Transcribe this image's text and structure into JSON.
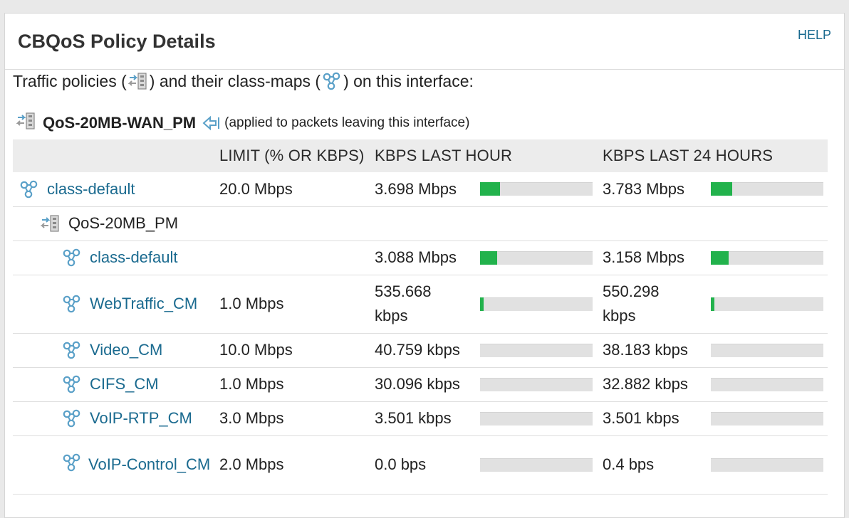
{
  "header": {
    "title": "CBQoS Policy Details",
    "help_label": "HELP"
  },
  "intro": {
    "part1": "Traffic policies (",
    "part2": ") and their class-maps (",
    "part3": ") on this interface:"
  },
  "policy": {
    "name": "QoS-20MB-WAN_PM",
    "note": "(applied to packets leaving this interface)"
  },
  "table": {
    "columns": [
      "",
      "LIMIT (% OR KBPS)",
      "KBPS LAST HOUR",
      "KBPS LAST 24 HOURS"
    ],
    "rows": [
      {
        "icon": "class-map-icon",
        "name": "class-default",
        "link": true,
        "limit": "20.0 Mbps",
        "hour": "3.698 Mbps",
        "hour_fill": 0.18,
        "day": "3.783 Mbps",
        "day_fill": 0.19
      },
      {
        "icon": "traffic-policy-icon",
        "name": "QoS-20MB_PM",
        "link": false,
        "limit": "",
        "hour": "",
        "hour_fill": null,
        "day": "",
        "day_fill": null
      },
      {
        "icon": "class-map-icon",
        "name": "class-default",
        "link": true,
        "limit": "",
        "hour": "3.088 Mbps",
        "hour_fill": 0.15,
        "day": "3.158 Mbps",
        "day_fill": 0.16
      },
      {
        "icon": "class-map-icon",
        "name": "WebTraffic_CM",
        "link": true,
        "limit": "1.0 Mbps",
        "hour": "535.668 kbps",
        "hour_fill": 0.03,
        "day": "550.298 kbps",
        "day_fill": 0.03
      },
      {
        "icon": "class-map-icon",
        "name": "Video_CM",
        "link": true,
        "limit": "10.0 Mbps",
        "hour": "40.759 kbps",
        "hour_fill": 0.0,
        "day": "38.183 kbps",
        "day_fill": 0.0
      },
      {
        "icon": "class-map-icon",
        "name": "CIFS_CM",
        "link": true,
        "limit": "1.0 Mbps",
        "hour": "30.096 kbps",
        "hour_fill": 0.0,
        "day": "32.882 kbps",
        "day_fill": 0.0
      },
      {
        "icon": "class-map-icon",
        "name": "VoIP-RTP_CM",
        "link": true,
        "limit": "3.0 Mbps",
        "hour": "3.501 kbps",
        "hour_fill": 0.0,
        "day": "3.501 kbps",
        "day_fill": 0.0
      },
      {
        "icon": "class-map-icon",
        "name": "VoIP-Control_CM",
        "link": true,
        "limit": "2.0 Mbps",
        "hour": "0.0 bps",
        "hour_fill": 0.0,
        "day": "0.4 bps",
        "day_fill": 0.0
      }
    ]
  },
  "colors": {
    "link": "#1a6a8f",
    "bar_fill": "#22b24c",
    "bar_track": "#e1e1e1",
    "header_bg": "#ececec"
  }
}
